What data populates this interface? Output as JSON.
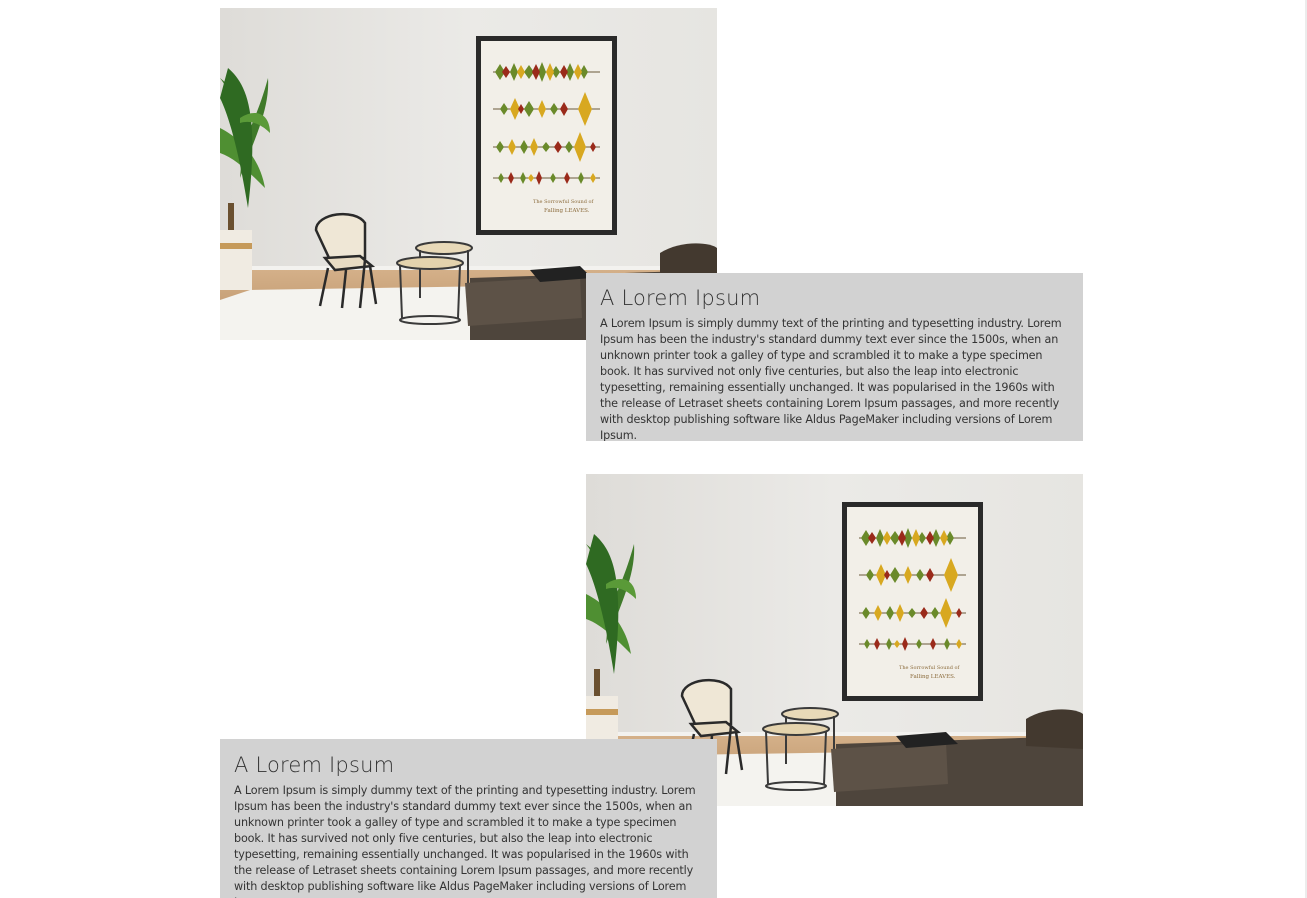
{
  "sections": [
    {
      "title": "A Lorem Ipsum",
      "body": "A Lorem Ipsum is simply dummy text of the printing and typesetting industry. Lorem Ipsum has been the industry's standard dummy text ever since the 1500s, when an unknown printer took a galley of type and scrambled it to make a type specimen book. It has survived not only five centuries, but also the leap into electronic typesetting, remaining essentially unchanged. It was popularised in the 1960s with the release of Letraset sheets containing Lorem Ipsum passages, and more recently with desktop publishing software like Aldus PageMaker including versions of Lorem Ipsum."
    },
    {
      "title": "A Lorem Ipsum",
      "body": "A Lorem Ipsum is simply dummy text of the printing and typesetting industry. Lorem Ipsum has been the industry's standard dummy text ever since the 1500s, when an unknown printer took a galley of type and scrambled it to make a type specimen book. It has survived not only five centuries, but also the leap into electronic typesetting, remaining essentially unchanged. It was popularised in the 1960s with the release of Letraset sheets containing Lorem Ipsum passages, and more recently with desktop publishing software like Aldus PageMaker including versions of Lorem Ipsum."
    }
  ],
  "poster": {
    "line1": "The Sorrowful Sound of",
    "line2": "Falling LEAVES."
  },
  "colors": {
    "card_background": "#d2d2d2",
    "text": "#333333",
    "wall": "#e9e8e5",
    "floor": "#c9a47c"
  }
}
